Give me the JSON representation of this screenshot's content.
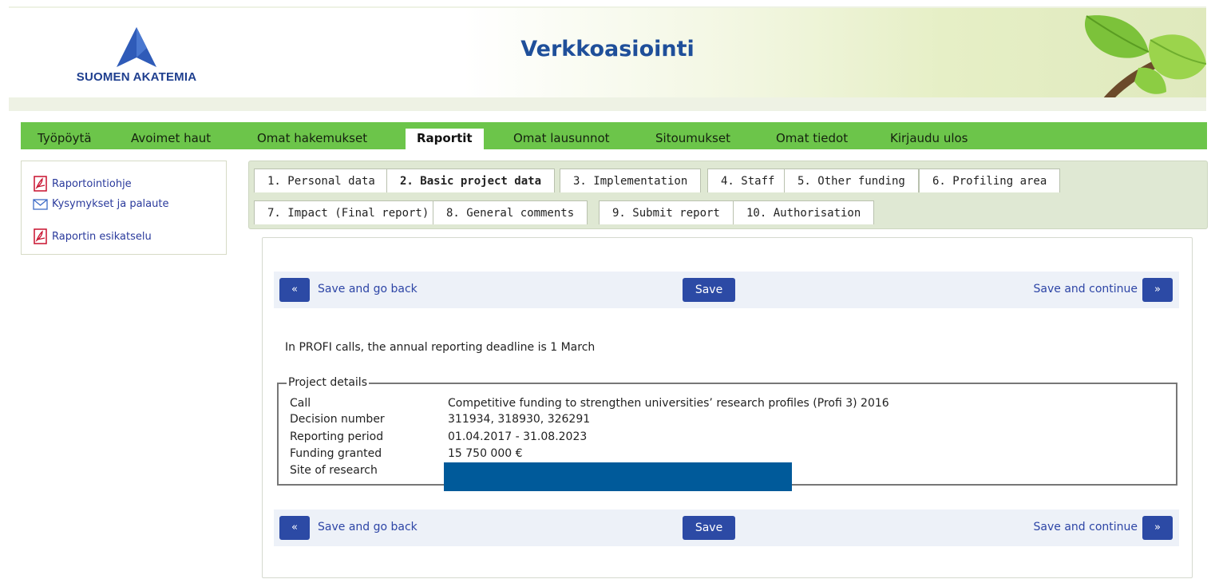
{
  "header": {
    "logo_text": "SUOMEN AKATEMIA",
    "site_title": "Verkkoasiointi"
  },
  "nav": {
    "items": [
      {
        "label": "Työpöytä"
      },
      {
        "label": "Avoimet haut"
      },
      {
        "label": "Omat hakemukset"
      },
      {
        "label": "Raportit",
        "active": true
      },
      {
        "label": "Omat lausunnot"
      },
      {
        "label": "Sitoumukset"
      },
      {
        "label": "Omat tiedot"
      },
      {
        "label": "Kirjaudu ulos"
      }
    ]
  },
  "sidebar": {
    "links": [
      {
        "label": "Raportointiohje",
        "icon": "pdf-icon"
      },
      {
        "label": "Kysymykset ja palaute",
        "icon": "mail-icon"
      },
      {
        "label": "Raportin esikatselu",
        "icon": "pdf-icon"
      }
    ]
  },
  "tabs": {
    "row1": [
      "1. Personal data",
      "2. Basic project data",
      "3. Implementation",
      "4. Staff",
      "5. Other funding",
      "6. Profiling area"
    ],
    "row2": [
      "7. Impact (Final report)",
      "8. General comments",
      "9. Submit report",
      "10. Authorisation"
    ],
    "active": "2. Basic project data"
  },
  "actions": {
    "back_symbol": "«",
    "back_label": "Save and go back",
    "save_label": "Save",
    "continue_label": "Save and continue",
    "continue_symbol": "»"
  },
  "notice": "In PROFI calls, the annual reporting deadline is 1 March",
  "project_details": {
    "legend": "Project details",
    "rows": [
      {
        "key": "Call",
        "value": "Competitive funding to strengthen universities’ research profiles (Profi 3) 2016"
      },
      {
        "key": "Decision number",
        "value": "311934, 318930, 326291"
      },
      {
        "key": "Reporting period",
        "value": "01.04.2017 - 31.08.2023"
      },
      {
        "key": "Funding granted",
        "value": "15 750 000 €"
      },
      {
        "key": "Site of research",
        "value": ""
      }
    ]
  },
  "colors": {
    "nav_green": "#6cc54a",
    "brand_blue": "#1f4f9a",
    "button_blue": "#2c4aa5",
    "redaction": "#005a9a"
  }
}
